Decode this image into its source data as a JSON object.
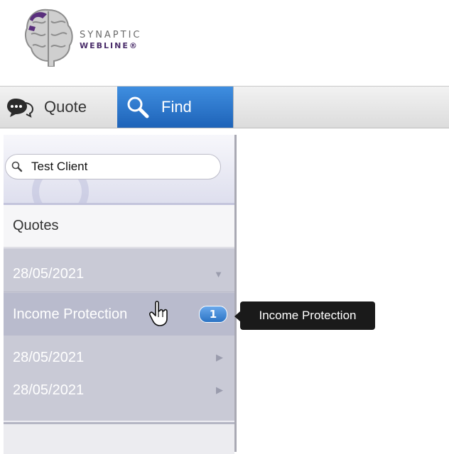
{
  "brand": {
    "line1": "SYNAPTIC",
    "line2": "WEBLINE®"
  },
  "tabs": {
    "quote": {
      "label": "Quote",
      "icon": "chat-bubble-icon"
    },
    "find": {
      "label": "Find",
      "icon": "magnifier-icon"
    }
  },
  "search": {
    "value": "Test Client",
    "icon": "search-icon"
  },
  "quotes": {
    "header": "Quotes",
    "items": [
      {
        "label": "28/05/2021",
        "icon": "chevron-down-icon"
      },
      {
        "label": "Income Protection",
        "badge": "1"
      },
      {
        "label": "28/05/2021",
        "icon": "chevron-right-icon"
      },
      {
        "label": "28/05/2021",
        "icon": "chevron-right-icon"
      }
    ]
  },
  "tooltip": {
    "text": "Income Protection"
  },
  "colors": {
    "accent": "#2b73c4",
    "list_bg": "#c9cad6",
    "tooltip_bg": "#1a1a1a"
  }
}
